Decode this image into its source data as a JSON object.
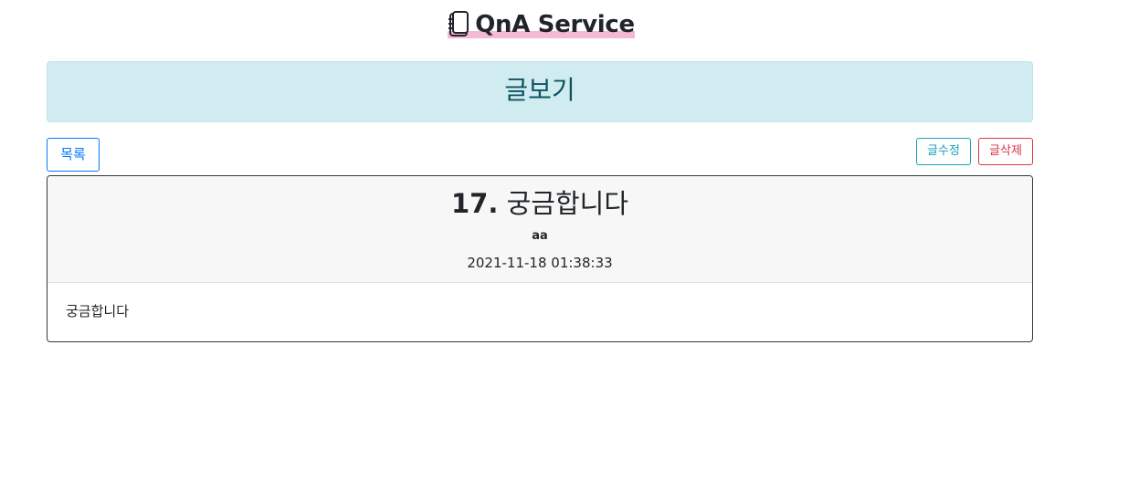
{
  "brand": {
    "icon": "notebook-icon",
    "title": "QnA Service",
    "highlight_color": "#f5b8d6"
  },
  "heading": {
    "text": "글보기",
    "bg_color": "#d1ecf1",
    "text_color": "#0c5460"
  },
  "toolbar": {
    "list_label": "목록",
    "edit_label": "글수정",
    "delete_label": "글삭제",
    "list_color": "#007bff",
    "edit_color": "#17a2b8",
    "delete_color": "#dc3545"
  },
  "post": {
    "number": "17.",
    "title": "궁금합니다",
    "author": "aa",
    "date": "2021-11-18 01:38:33",
    "content": "궁금합니다"
  }
}
